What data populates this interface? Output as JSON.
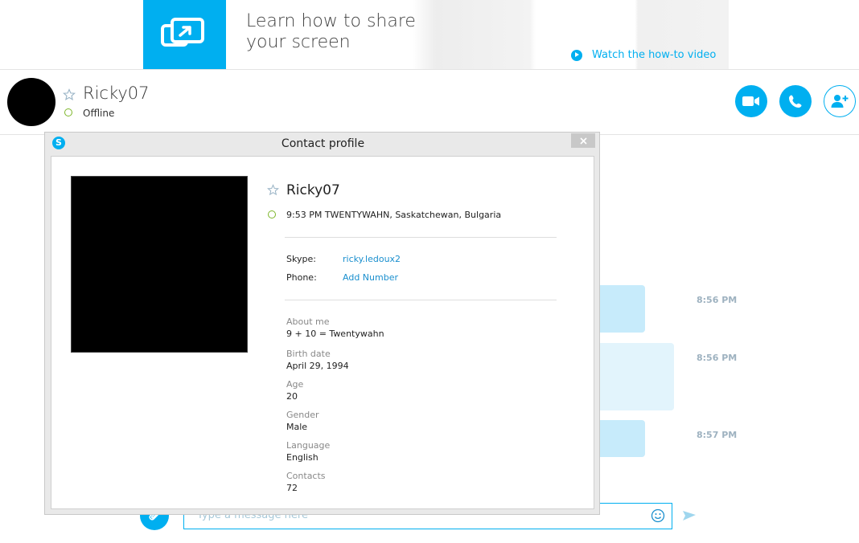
{
  "ad": {
    "title": "Learn how to share your screen",
    "link": "Watch the how-to video"
  },
  "header": {
    "name": "Ricky07",
    "status": "Offline"
  },
  "chat": {
    "times": [
      "8:56 PM",
      "8:56 PM",
      "8:57 PM"
    ],
    "composer_placeholder": "Type a message here"
  },
  "dialog": {
    "title": "Contact profile",
    "name": "Ricky07",
    "location": "9:53 PM TWENTYWAHN, Saskatchewan, Bulgaria",
    "skype_label": "Skype:",
    "skype_value": "ricky.ledoux2",
    "phone_label": "Phone:",
    "phone_value": "Add Number",
    "fields": [
      {
        "label": "About me",
        "value": "9 + 10 = Twentywahn"
      },
      {
        "label": "Birth date",
        "value": "April 29, 1994"
      },
      {
        "label": "Age",
        "value": "20"
      },
      {
        "label": "Gender",
        "value": "Male"
      },
      {
        "label": "Language",
        "value": "English"
      },
      {
        "label": "Contacts",
        "value": "72"
      }
    ]
  },
  "colors": {
    "accent": "#00aff0",
    "presence_ring": "#7db62a",
    "link": "#1a8fce",
    "bubble": "#c7ebfb"
  }
}
